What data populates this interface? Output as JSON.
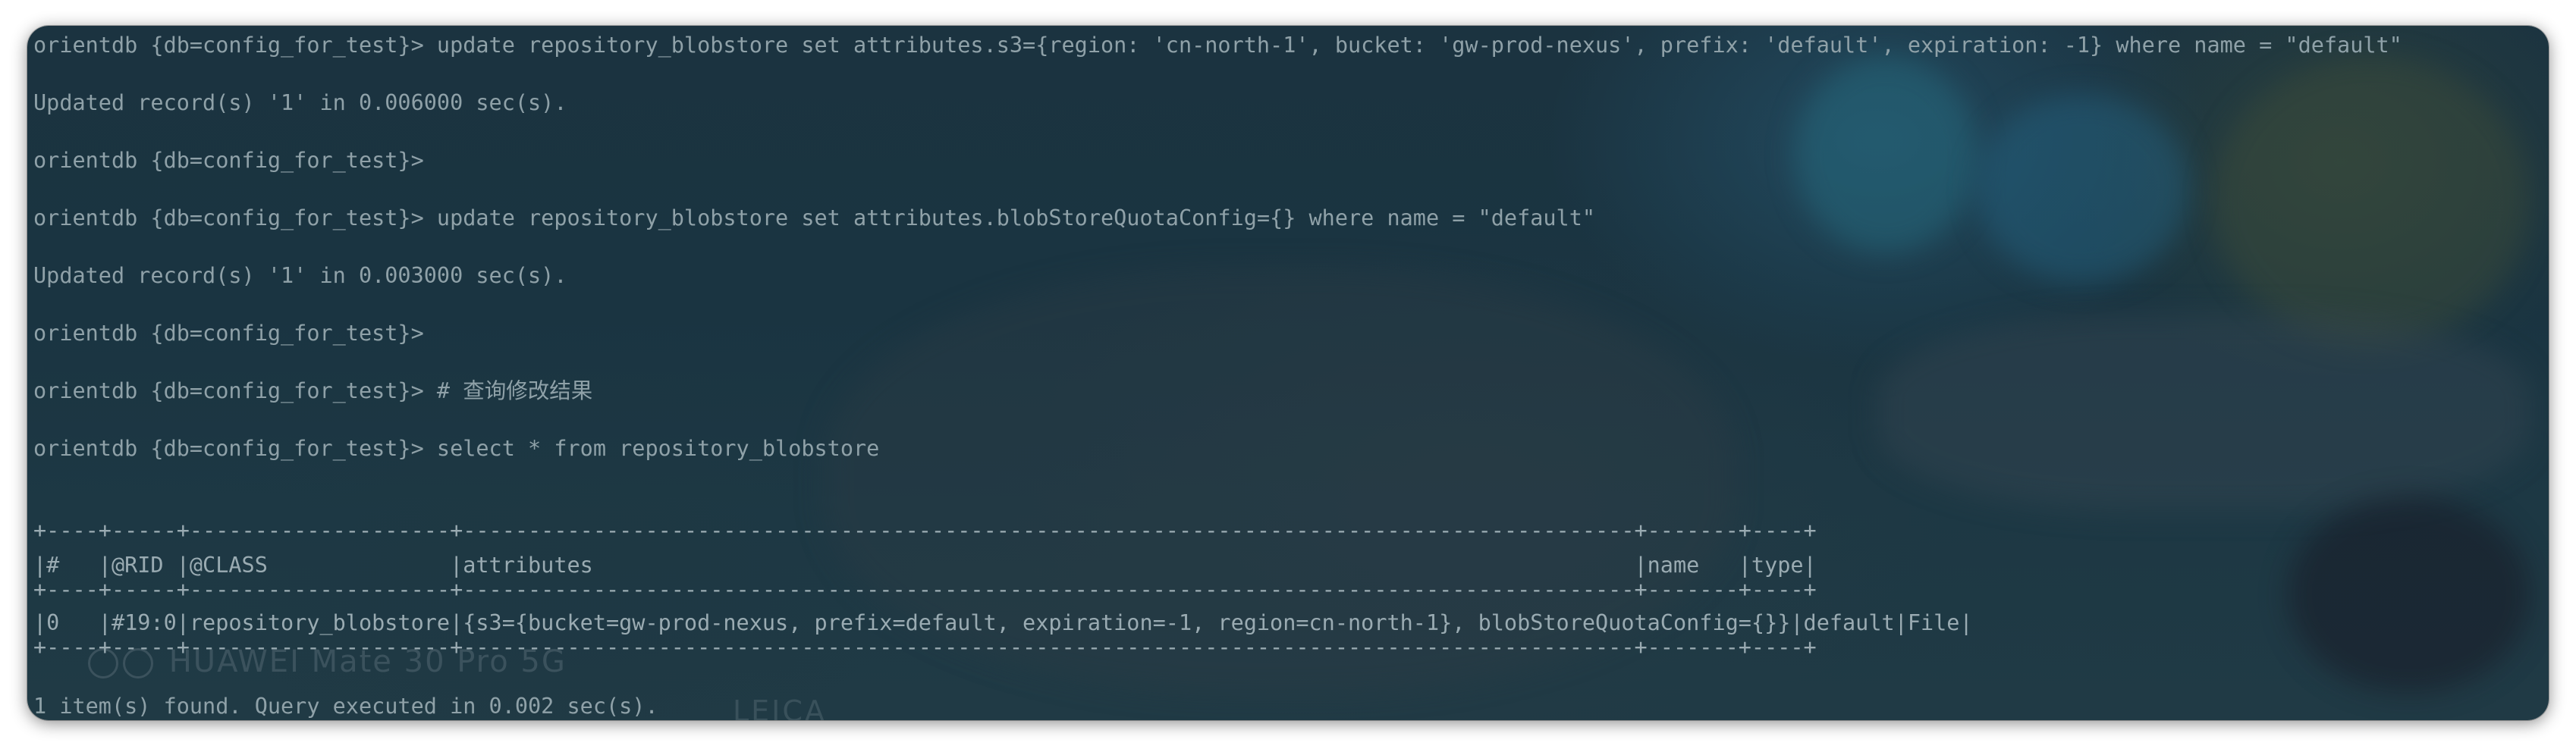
{
  "terminal": {
    "lines": [
      "orientdb {db=config_for_test}> update repository_blobstore set attributes.s3={region: 'cn-north-1', bucket: 'gw-prod-nexus', prefix: 'default', expiration: -1} where name = \"default\"",
      "Updated record(s) '1' in 0.006000 sec(s).",
      "orientdb {db=config_for_test}>",
      "orientdb {db=config_for_test}> update repository_blobstore set attributes.blobStoreQuotaConfig={} where name = \"default\"",
      "Updated record(s) '1' in 0.003000 sec(s).",
      "orientdb {db=config_for_test}>",
      "orientdb {db=config_for_test}> # 查询修改结果",
      "orientdb {db=config_for_test}> select * from repository_blobstore"
    ],
    "table": {
      "border": "+----+-----+--------------------+------------------------------------------------------------------------------------------+-------+----+",
      "header": "|#   |@RID |@CLASS              |attributes                                                                                |name   |type|",
      "row": "|0   |#19:0|repository_blobstore|{s3={bucket=gw-prod-nexus, prefix=default, expiration=-1, region=cn-north-1}, blobStoreQuotaConfig={}}|default|File|"
    },
    "footer": "1 item(s) found. Query executed in 0.002 sec(s).",
    "watermark_line1": "HUAWEI Mate 30 Pro 5G",
    "watermark_line2": "LEICA"
  },
  "colors": {
    "text": "#8fa1a8",
    "background": "#1b3340"
  }
}
